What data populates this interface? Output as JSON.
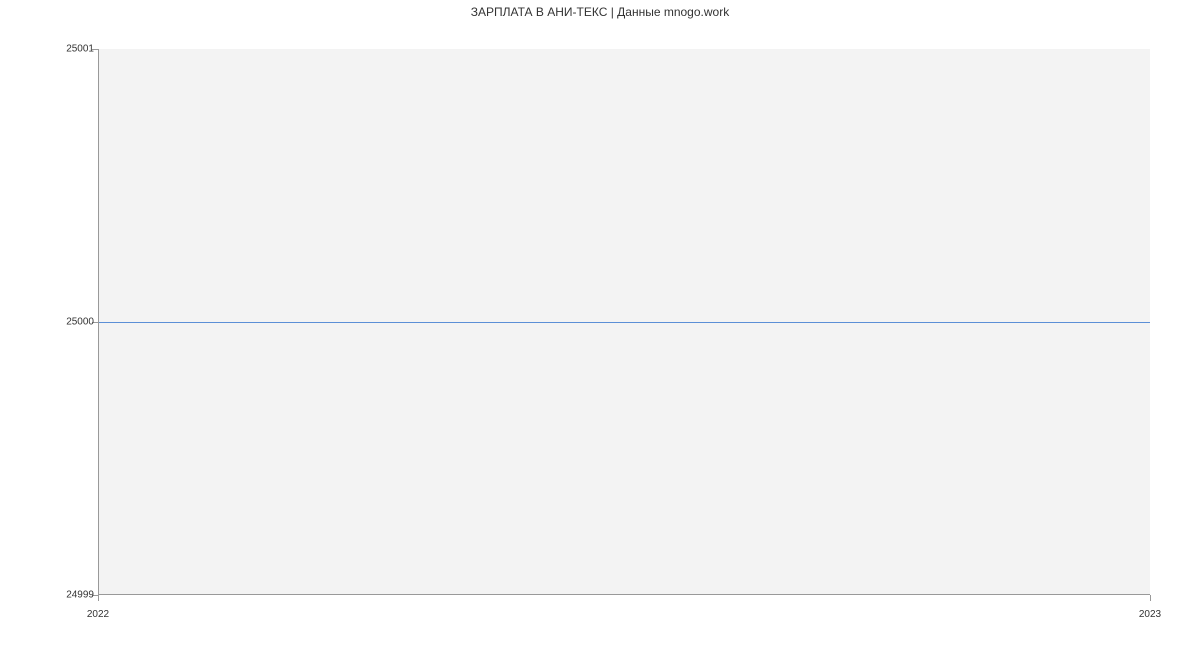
{
  "chart_data": {
    "type": "line",
    "title": "ЗАРПЛАТА В АНИ-ТЕКС | Данные mnogo.work",
    "xlabel": "",
    "ylabel": "",
    "x": [
      2022,
      2023
    ],
    "values": [
      25000,
      25000
    ],
    "x_ticks": [
      "2022",
      "2023"
    ],
    "y_ticks": [
      "24999",
      "25000",
      "25001"
    ],
    "xlim": [
      2022,
      2023
    ],
    "ylim": [
      24999,
      25001
    ],
    "line_color": "#5b8fd6",
    "plot_bg": "#f3f3f3"
  }
}
